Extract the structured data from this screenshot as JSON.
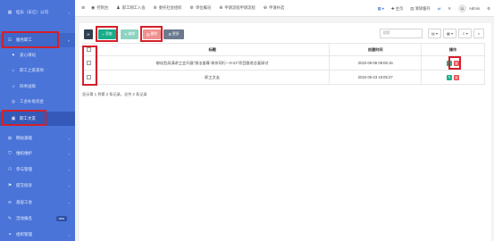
{
  "sidebar": {
    "items": [
      {
        "label": "桂乐（乐亿）公司",
        "icon": "building-icon",
        "chevron": "‹"
      },
      {
        "label": "服务职工",
        "icon": "user-group-icon",
        "chevron": "˅"
      },
      {
        "label": "爱心驿站",
        "icon": "heart-icon"
      },
      {
        "label": "职工之家基地",
        "icon": "home-icon"
      },
      {
        "label": "四季送暖",
        "icon": "sun-icon"
      },
      {
        "label": "工会补助资金",
        "icon": "coin-icon"
      },
      {
        "label": "职工文友",
        "icon": "book-icon"
      },
      {
        "label": "网站基础",
        "icon": "globe-icon",
        "chevron": "‹"
      },
      {
        "label": "维权维护",
        "icon": "shield-icon",
        "chevron": "‹"
      },
      {
        "label": "参与管理",
        "icon": "users-icon",
        "chevron": "‹"
      },
      {
        "label": "提交投诉",
        "icon": "flag-icon",
        "chevron": "‹"
      },
      {
        "label": "基层工会",
        "icon": "layers-icon",
        "chevron": "‹"
      },
      {
        "label": "活动报名",
        "icon": "pen-icon",
        "badge": "new"
      },
      {
        "label": "组织管理",
        "icon": "org-icon",
        "chevron": "‹"
      }
    ]
  },
  "topbar": {
    "nav": [
      {
        "label": "控制台",
        "icon": "dashboard-icon"
      },
      {
        "label": "职工网工入会",
        "icon": "user-add-icon"
      },
      {
        "label": "委托社会组织",
        "icon": "org-icon"
      },
      {
        "label": "单位概况",
        "icon": "gear-icon"
      },
      {
        "label": "申请流程申请流程",
        "icon": "apply-icon"
      },
      {
        "label": "申请补选",
        "icon": "apply-icon"
      }
    ],
    "right": {
      "home": "主页",
      "clear_cache": "清除缓存",
      "user": "Admin"
    }
  },
  "toolbar": {
    "refresh": "⟳",
    "add": "添加",
    "edit": "编辑",
    "delete": "删除",
    "more": "更多",
    "search_placeholder": "搜索"
  },
  "table": {
    "headers": [
      "标题",
      "创建时间",
      "操作"
    ],
    "rows": [
      {
        "title": "郁化危局演讲工会开展\"扬法鉴尊·致伴同行—0-21\"项目跟进总复探讨",
        "time": "2022-06-08 09:06:16"
      },
      {
        "title": "职工文友",
        "time": "2022-05-23 15:05:27"
      }
    ]
  },
  "footer": {
    "info": "显示第 1 到第 2 条记录，总共 2 条记录"
  },
  "colors": {
    "sidebar": "#4a74d8",
    "add": "#1aad8a",
    "edit": "#8cd4c1",
    "delete": "#f0908f",
    "more": "#6b7a8f",
    "highlight": "#d4202a"
  }
}
